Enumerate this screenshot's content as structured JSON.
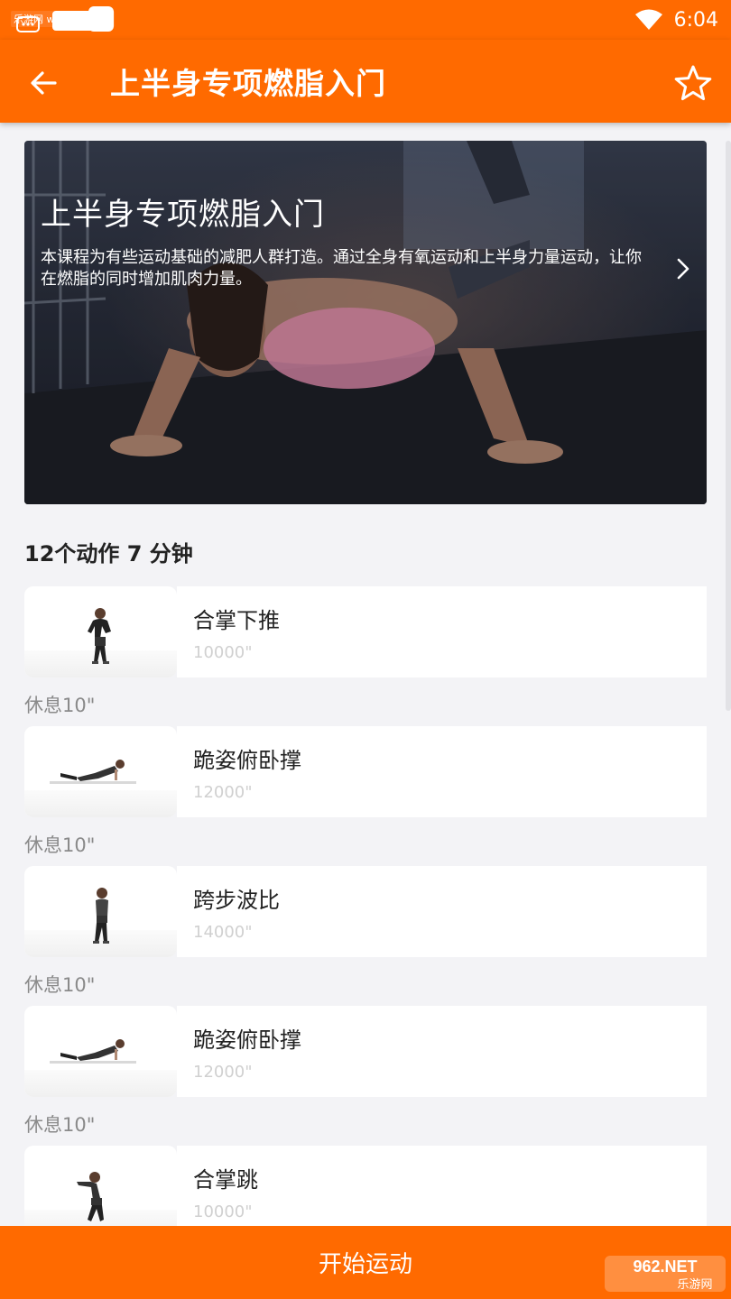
{
  "status_bar": {
    "badge_text": "乐游网 www.962.net",
    "time": "6:04"
  },
  "app_bar": {
    "title": "上半身专项燃脂入门",
    "back_icon": "arrow-left-icon",
    "favorite_icon": "star-outline-icon"
  },
  "hero": {
    "title": "上半身专项燃脂入门",
    "description": "本课程为有些运动基础的减肥人群打造。通过全身有氧运动和上半身力量运动，让你在燃脂的同时增加肌肉力量。"
  },
  "summary": {
    "text": "12个动作  7 分钟"
  },
  "exercises": [
    {
      "name": "合掌下推",
      "duration": "10000\"",
      "pose": "standing"
    },
    {
      "name": "跪姿俯卧撑",
      "duration": "12000\"",
      "pose": "pushup"
    },
    {
      "name": "跨步波比",
      "duration": "14000\"",
      "pose": "standing"
    },
    {
      "name": "跪姿俯卧撑",
      "duration": "12000\"",
      "pose": "pushup"
    },
    {
      "name": "合掌跳",
      "duration": "10000\"",
      "pose": "jump"
    }
  ],
  "rests": [
    "休息10\"",
    "休息10\"",
    "休息10\"",
    "休息10\""
  ],
  "start_button": {
    "label": "开始运动"
  },
  "watermark": {
    "top_text": "962.NET",
    "bottom_text": "乐游网"
  },
  "colors": {
    "brand": "#ff6a00",
    "background": "#f3f3f6"
  }
}
